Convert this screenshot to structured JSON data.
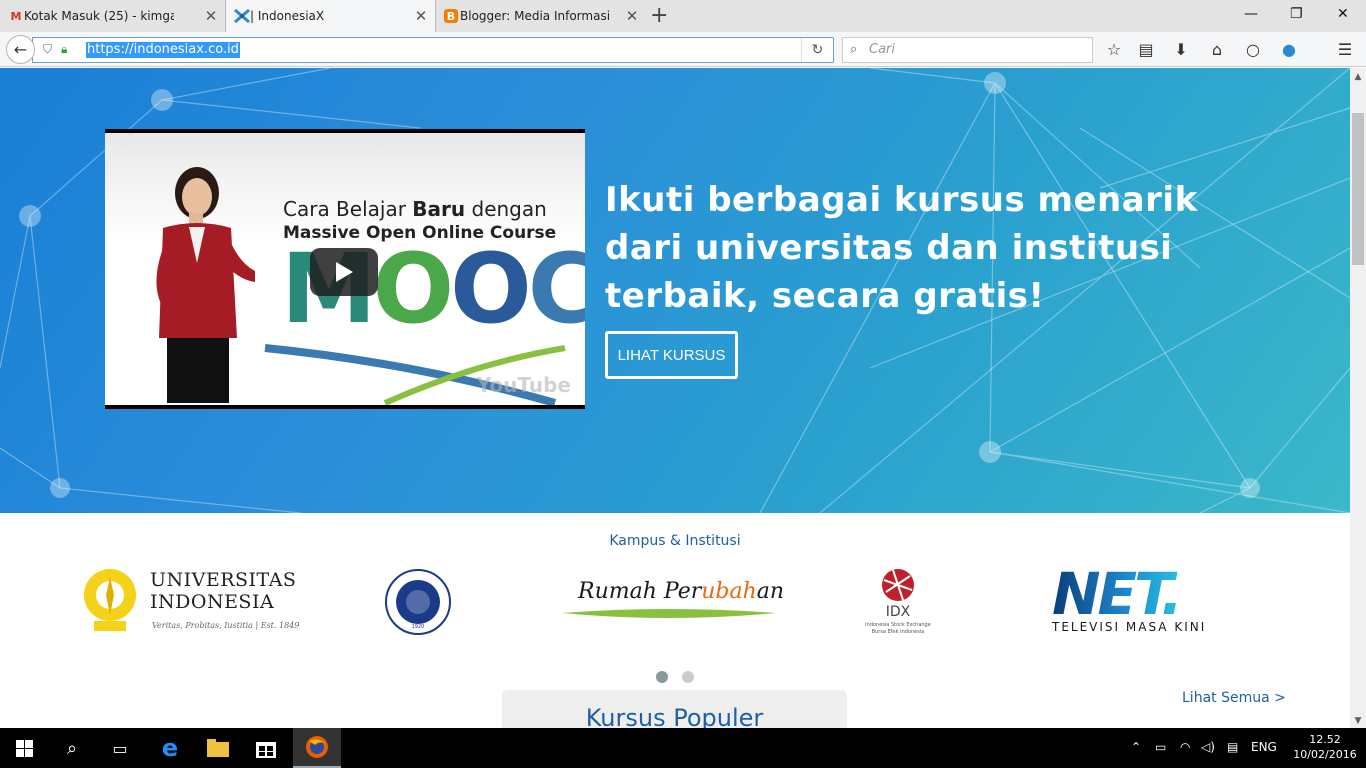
{
  "browser": {
    "tabs": [
      {
        "title": "Kotak Masuk (25) - kimgat...",
        "favicon": "gmail-icon",
        "close": "✕"
      },
      {
        "title": "| IndonesiaX",
        "favicon": "indonesiax-icon",
        "close": "✕"
      },
      {
        "title": "Blogger: Media Informasi ...",
        "favicon": "blogger-icon",
        "close": "✕"
      }
    ],
    "new_tab": "+",
    "window": {
      "minimize": "—",
      "restore": "❐",
      "close": "✕"
    },
    "url": "https://indonesiax.co.id",
    "search_placeholder": "Cari",
    "toolbar_icons": [
      "star-icon",
      "reading-list-icon",
      "download-icon",
      "home-icon",
      "chat-icon",
      "sync-icon",
      "menu-icon"
    ]
  },
  "hero": {
    "heading": "Ikuti berbagai kursus menarik dari universitas dan institusi terbaik, secara gratis!",
    "cta_label": "LIHAT KURSUS",
    "video": {
      "line1_prefix": "Cara Belajar ",
      "line1_bold": "Baru",
      "line1_suffix": " dengan",
      "line2": "Massive Open Online Course",
      "mooc_letters": [
        "M",
        "O",
        "O",
        "C"
      ],
      "mooc_colors": [
        "#2a8a7a",
        "#4aa84a",
        "#2a5a9a",
        "#3a7ab0"
      ],
      "watermark": "YouTube"
    }
  },
  "partners": {
    "section_title": "Kampus & Institusi",
    "logos": [
      {
        "name": "UNIVERSITAS",
        "name2": "INDONESIA",
        "tagline": "Veritas, Probitas, Iustitia | Est. 1849"
      },
      {
        "name": "INSTITUT TEKNOLOGI BANDUNG",
        "year": "1920"
      },
      {
        "name_prefix": "Rumah Per",
        "name_accent": "ubah",
        "name_suffix": "an"
      },
      {
        "name": "IDX",
        "sub1": "Indonesia Stock Exchange",
        "sub2": "Bursa Efek Indonesia"
      },
      {
        "name": "NET.",
        "tagline": "TELEVISI MASA KINI"
      }
    ],
    "carousel_active": 1,
    "carousel_total": 2
  },
  "courses": {
    "section_title": "Kursus Populer",
    "see_all": "Lihat Semua >"
  },
  "taskbar": {
    "lang": "ENG",
    "time": "12.52",
    "date": "10/02/2016"
  }
}
